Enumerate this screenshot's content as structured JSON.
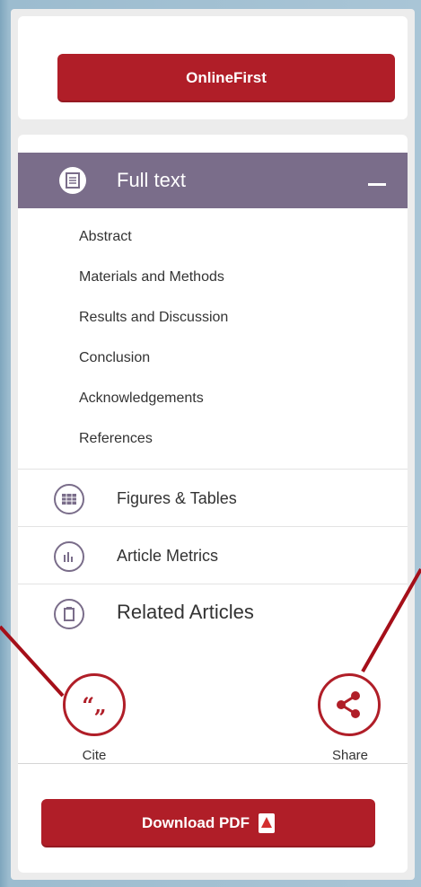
{
  "buttons": {
    "onlinefirst": "OnlineFirst",
    "download_pdf": "Download PDF"
  },
  "full_text": {
    "label": "Full text",
    "sections": [
      "Abstract",
      "Materials and Methods",
      "Results and Discussion",
      "Conclusion",
      "Acknowledgements",
      "References"
    ]
  },
  "rows": {
    "figures": "Figures & Tables",
    "metrics": "Article Metrics",
    "related": "Related Articles"
  },
  "actions": {
    "cite": "Cite",
    "share": "Share"
  },
  "colors": {
    "accent": "#b01e28",
    "header": "#7a6d8a"
  }
}
